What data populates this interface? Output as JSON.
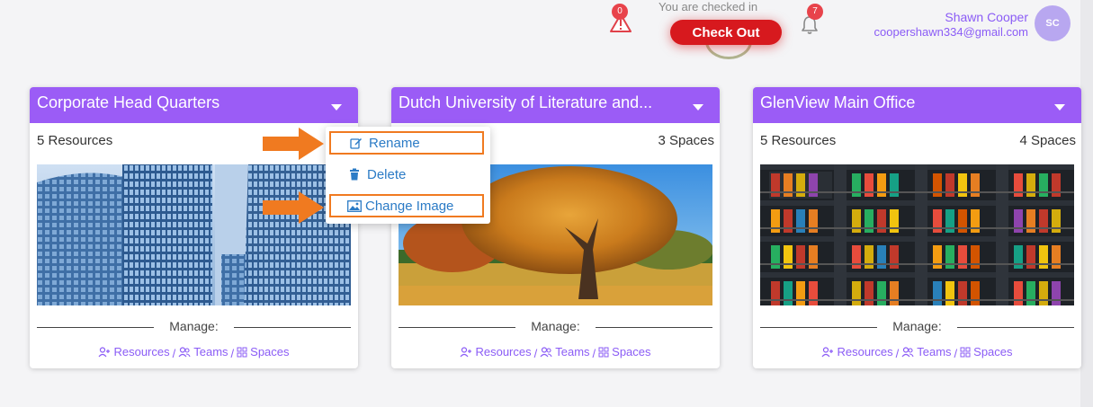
{
  "header": {
    "alerts_count": "0",
    "notifications_count": "7",
    "checkin_status": "You are checked in",
    "checkout_label": "Check Out",
    "user_name": "Shawn Cooper",
    "user_email": "coopershawn334@gmail.com",
    "avatar_initials": "SC"
  },
  "cards": [
    {
      "title": "Corporate Head Quarters",
      "resources": "5 Resources",
      "spaces": "",
      "image": "office-buildings-photo",
      "manage_label": "Manage:",
      "links": {
        "resources": "Resources",
        "teams": "Teams",
        "spaces": "Spaces",
        "separator": "/"
      }
    },
    {
      "title": "Dutch University of Literature and...",
      "resources": "",
      "spaces": "3 Spaces",
      "image": "autumn-tree-photo",
      "manage_label": "Manage:",
      "links": {
        "resources": "Resources",
        "teams": "Teams",
        "spaces": "Spaces",
        "separator": "/"
      }
    },
    {
      "title": "GlenView Main Office",
      "resources": "5 Resources",
      "spaces": "4 Spaces",
      "image": "colorful-building-doors-photo",
      "manage_label": "Manage:",
      "links": {
        "resources": "Resources",
        "teams": "Teams",
        "spaces": "Spaces",
        "separator": "/"
      }
    }
  ],
  "menu": {
    "rename": "Rename",
    "delete": "Delete",
    "change_image": "Change Image"
  },
  "colors": {
    "accent": "#9b5cf6",
    "checkout": "#d7191e",
    "badge": "#e8434b",
    "menu_text": "#2b7bc6",
    "highlight": "#f07a20"
  },
  "icons": {
    "alert": "warning-triangle-icon",
    "bell": "bell-icon",
    "rename": "edit-icon",
    "delete": "trash-icon",
    "change_image": "image-icon",
    "resources": "user-plus-icon",
    "teams": "users-icon",
    "spaces": "grid-icon",
    "dropdown": "caret-down-icon"
  }
}
